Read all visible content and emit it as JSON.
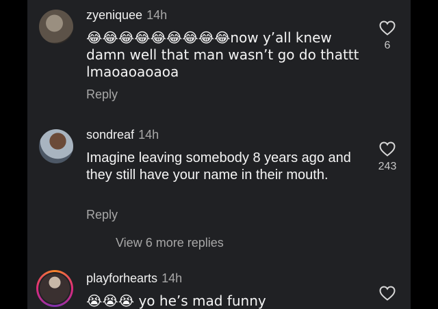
{
  "comments": [
    {
      "username": "zyeniquee",
      "time": "14h",
      "text": "😂😂😂😂😂😂😂😂😂now y’all knew damn well that man wasn’t go do thattt lmaoaoaoaoa",
      "reply_label": "Reply",
      "likes": "6"
    },
    {
      "username": "sondreaf",
      "time": "14h",
      "text": "Imagine leaving somebody 8 years ago and they still have your name in their mouth.",
      "reply_label": "Reply",
      "likes": "243"
    },
    {
      "username": "playforhearts",
      "time": "14h",
      "text": "😭😭😭 yo he’s mad funny"
    }
  ],
  "view_more": "View 6 more replies",
  "colors": {
    "background": "#202124",
    "outer": "#000000",
    "text": "#f5f5f5",
    "muted": "#a8a8a8"
  },
  "icons": [
    "heart-icon"
  ]
}
